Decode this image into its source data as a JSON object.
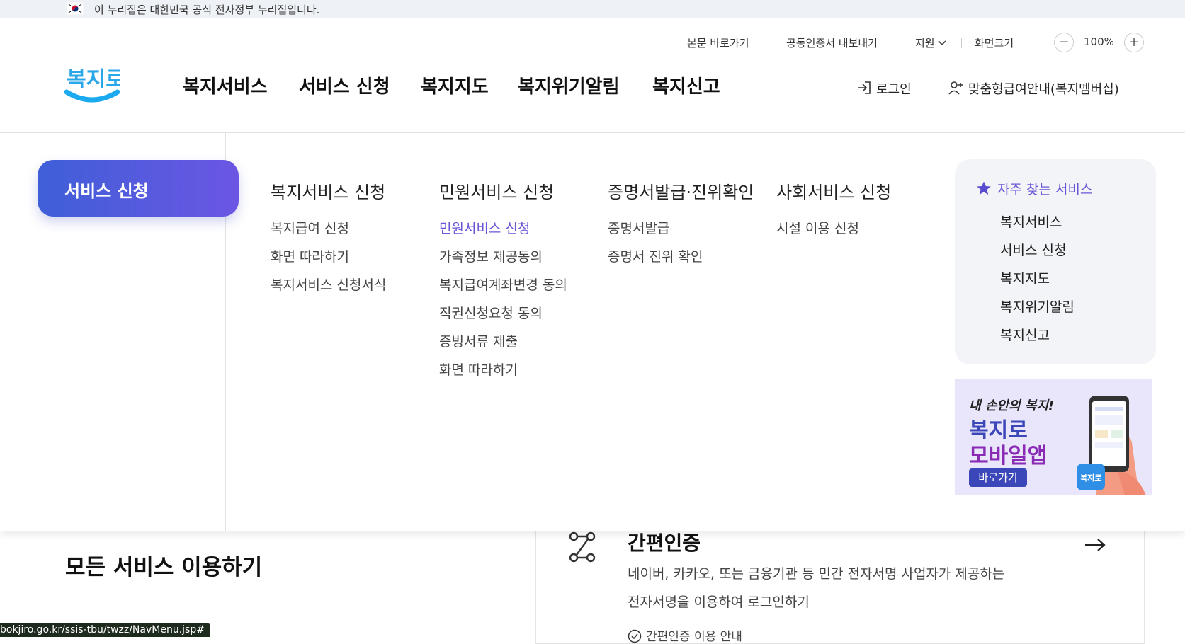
{
  "gov_banner": {
    "text": "이 누리집은 대한민국 공식 전자정부 누리집입니다."
  },
  "utility": {
    "skip": "본문 바로가기",
    "cert": "공동인증서 내보내기",
    "support": "지원",
    "screen_size": "화면크기",
    "zoom": "100%",
    "zoom_out": "−",
    "zoom_in": "+"
  },
  "logo": {
    "text": "복지로"
  },
  "gnb": [
    "복지서비스",
    "서비스 신청",
    "복지지도",
    "복지위기알림",
    "복지신고"
  ],
  "account": {
    "login": "로그인",
    "membership": "맞춤형급여안내(복지멤버십)"
  },
  "mega": {
    "active": "서비스 신청",
    "columns": [
      {
        "title": "복지서비스 신청",
        "items": [
          "복지급여 신청",
          "화면 따라하기",
          "복지서비스 신청서식"
        ]
      },
      {
        "title": "민원서비스 신청",
        "items": [
          "민원서비스 신청",
          "가족정보 제공동의",
          "복지급여계좌변경 동의",
          "직권신청요청 동의",
          "증빙서류 제출",
          "화면 따라하기"
        ]
      },
      {
        "title": "증명서발급·진위확인",
        "items": [
          "증명서발급",
          "증명서 진위 확인"
        ]
      },
      {
        "title": "사회서비스 신청",
        "items": [
          "시설 이용 신청"
        ]
      }
    ],
    "favorites": {
      "title": "자주 찾는 서비스",
      "items": [
        "복지서비스",
        "서비스 신청",
        "복지지도",
        "복지위기알림",
        "복지신고"
      ]
    },
    "banner": {
      "small": "내 손안의 복지!",
      "line1": "복지로",
      "line2": "모바일앱",
      "button": "바로가기",
      "badge": "복지로"
    }
  },
  "below": {
    "title": "모든 서비스 이용하기",
    "card": {
      "title": "간편인증",
      "desc1": "네이버, 카카오, 또는 금융기관 등 민간 전자서명 사업자가 제공하는",
      "desc2": "전자서명을 이용하여 로그인하기",
      "sub": "간편인증 이용 안내"
    }
  },
  "status_url": "bokjiro.go.kr/ssis-tbu/twzz/NavMenu.jsp#",
  "colors": {
    "accent": "#6a55d8",
    "pill_start": "#3f5fd8",
    "pill_end": "#6b56e3",
    "banner_bg": "#e9e6fb"
  }
}
